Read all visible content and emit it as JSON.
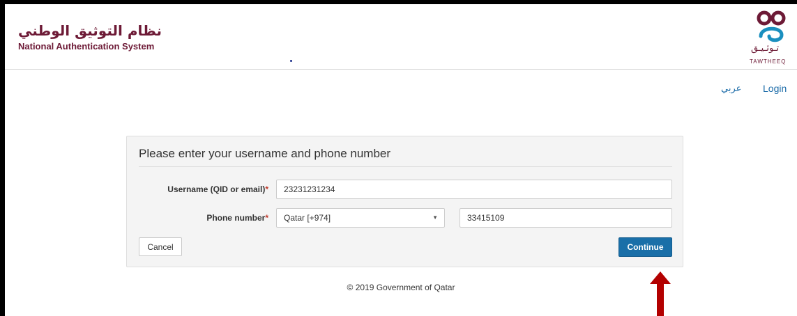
{
  "header": {
    "title_ar": "نظام التوثيق الوطني",
    "title_en": "National Authentication System",
    "logo_text_ar": "تـوثـيـق",
    "logo_text_en": "TAWTHEEQ"
  },
  "nav": {
    "language": "عربي",
    "login": "Login"
  },
  "form": {
    "title": "Please enter your username and phone number",
    "username": {
      "label": "Username (QID or email)",
      "required_mark": "*",
      "value": "23231231234"
    },
    "phone": {
      "label": "Phone number",
      "required_mark": "*",
      "country_selected": "Qatar [+974]",
      "number_value": "33415109"
    },
    "cancel_label": "Cancel",
    "continue_label": "Continue"
  },
  "footer": {
    "copyright": "© 2019 Government of Qatar"
  },
  "colors": {
    "brand": "#6d1a36",
    "link": "#1b6ba8",
    "primary_button": "#1a6fa8",
    "annotation_arrow": "#b30000"
  }
}
